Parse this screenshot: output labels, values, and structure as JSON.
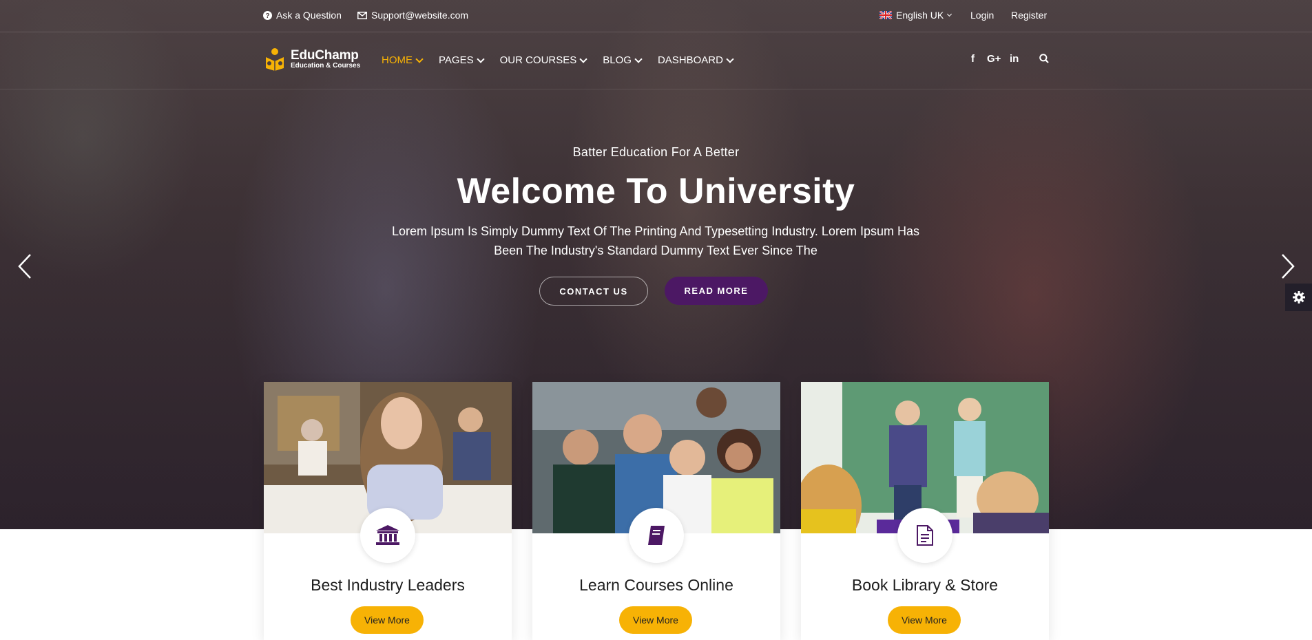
{
  "topbar": {
    "ask": "Ask a Question",
    "email": "Support@website.com",
    "language": "English UK",
    "login": "Login",
    "register": "Register"
  },
  "brand": {
    "name": "EduChamp",
    "tagline": "Education & Courses"
  },
  "nav": {
    "items": [
      {
        "label": "HOME",
        "active": true
      },
      {
        "label": "PAGES",
        "active": false
      },
      {
        "label": "OUR COURSES",
        "active": false
      },
      {
        "label": "BLOG",
        "active": false
      },
      {
        "label": "DASHBOARD",
        "active": false
      }
    ]
  },
  "hero": {
    "subtitle": "Batter Education For A Better",
    "title": "Welcome To University",
    "description": "Lorem Ipsum Is Simply Dummy Text Of The Printing And Typesetting Industry. Lorem Ipsum Has Been The Industry's Standard Dummy Text Ever Since The",
    "contact_label": "CONTACT US",
    "read_more_label": "READ MORE"
  },
  "features": [
    {
      "title": "Best Industry Leaders",
      "button": "View More",
      "icon": "bank-icon"
    },
    {
      "title": "Learn Courses Online",
      "button": "View More",
      "icon": "book-icon"
    },
    {
      "title": "Book Library & Store",
      "button": "View More",
      "icon": "document-icon"
    }
  ],
  "colors": {
    "accent_yellow": "#f7b205",
    "brand_purple": "#4c1864"
  }
}
